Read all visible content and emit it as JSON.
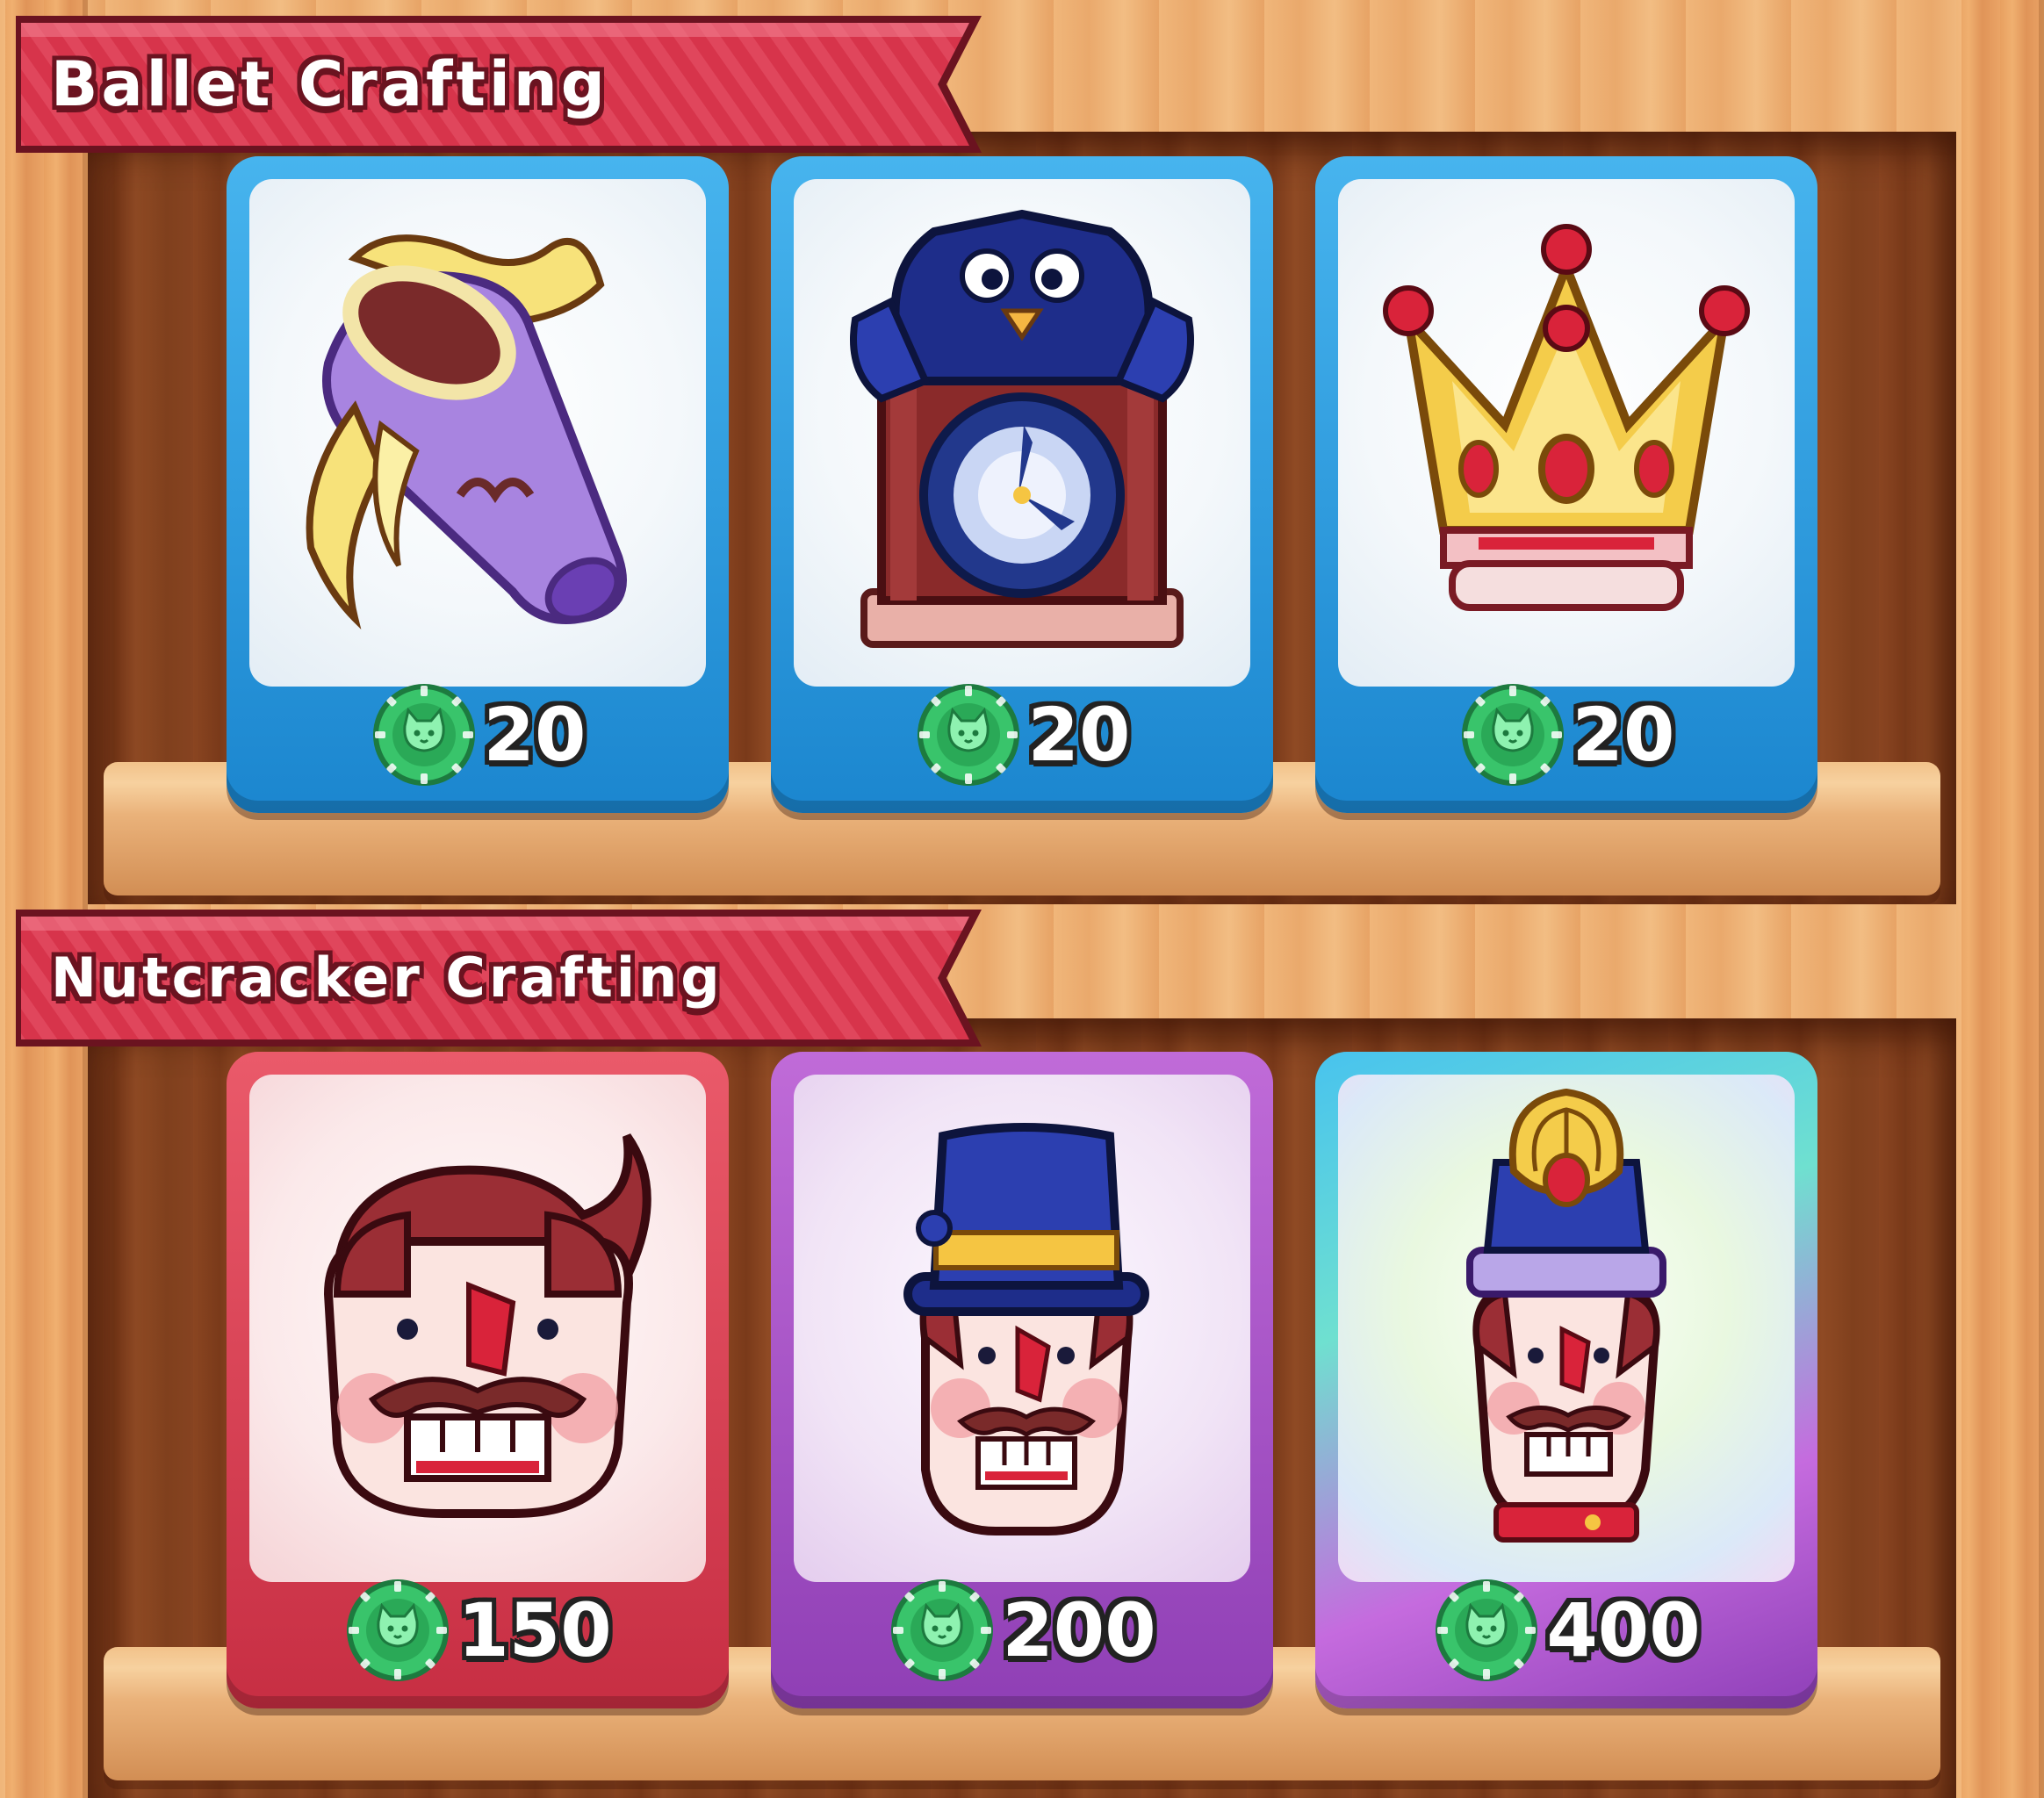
{
  "sections": [
    {
      "title": "Ballet Crafting",
      "items": [
        {
          "name": "ballet-slipper",
          "price": "20",
          "rarity": "blue"
        },
        {
          "name": "cuckoo-clock",
          "price": "20",
          "rarity": "blue"
        },
        {
          "name": "crown",
          "price": "20",
          "rarity": "blue"
        }
      ]
    },
    {
      "title": "Nutcracker Crafting",
      "items": [
        {
          "name": "nutcracker-head",
          "price": "150",
          "rarity": "red"
        },
        {
          "name": "nutcracker-top-hat",
          "price": "200",
          "rarity": "purple"
        },
        {
          "name": "nutcracker-king",
          "price": "400",
          "rarity": "rainbow"
        }
      ]
    }
  ],
  "currency": {
    "icon": "green-cat-coin-icon"
  },
  "colors": {
    "banner": "#d7344b",
    "banner_outline": "#6b1320",
    "card_blue": "#2a9ee0",
    "card_red": "#dc4458",
    "card_purple": "#a853c9",
    "coin": "#34c46a"
  }
}
